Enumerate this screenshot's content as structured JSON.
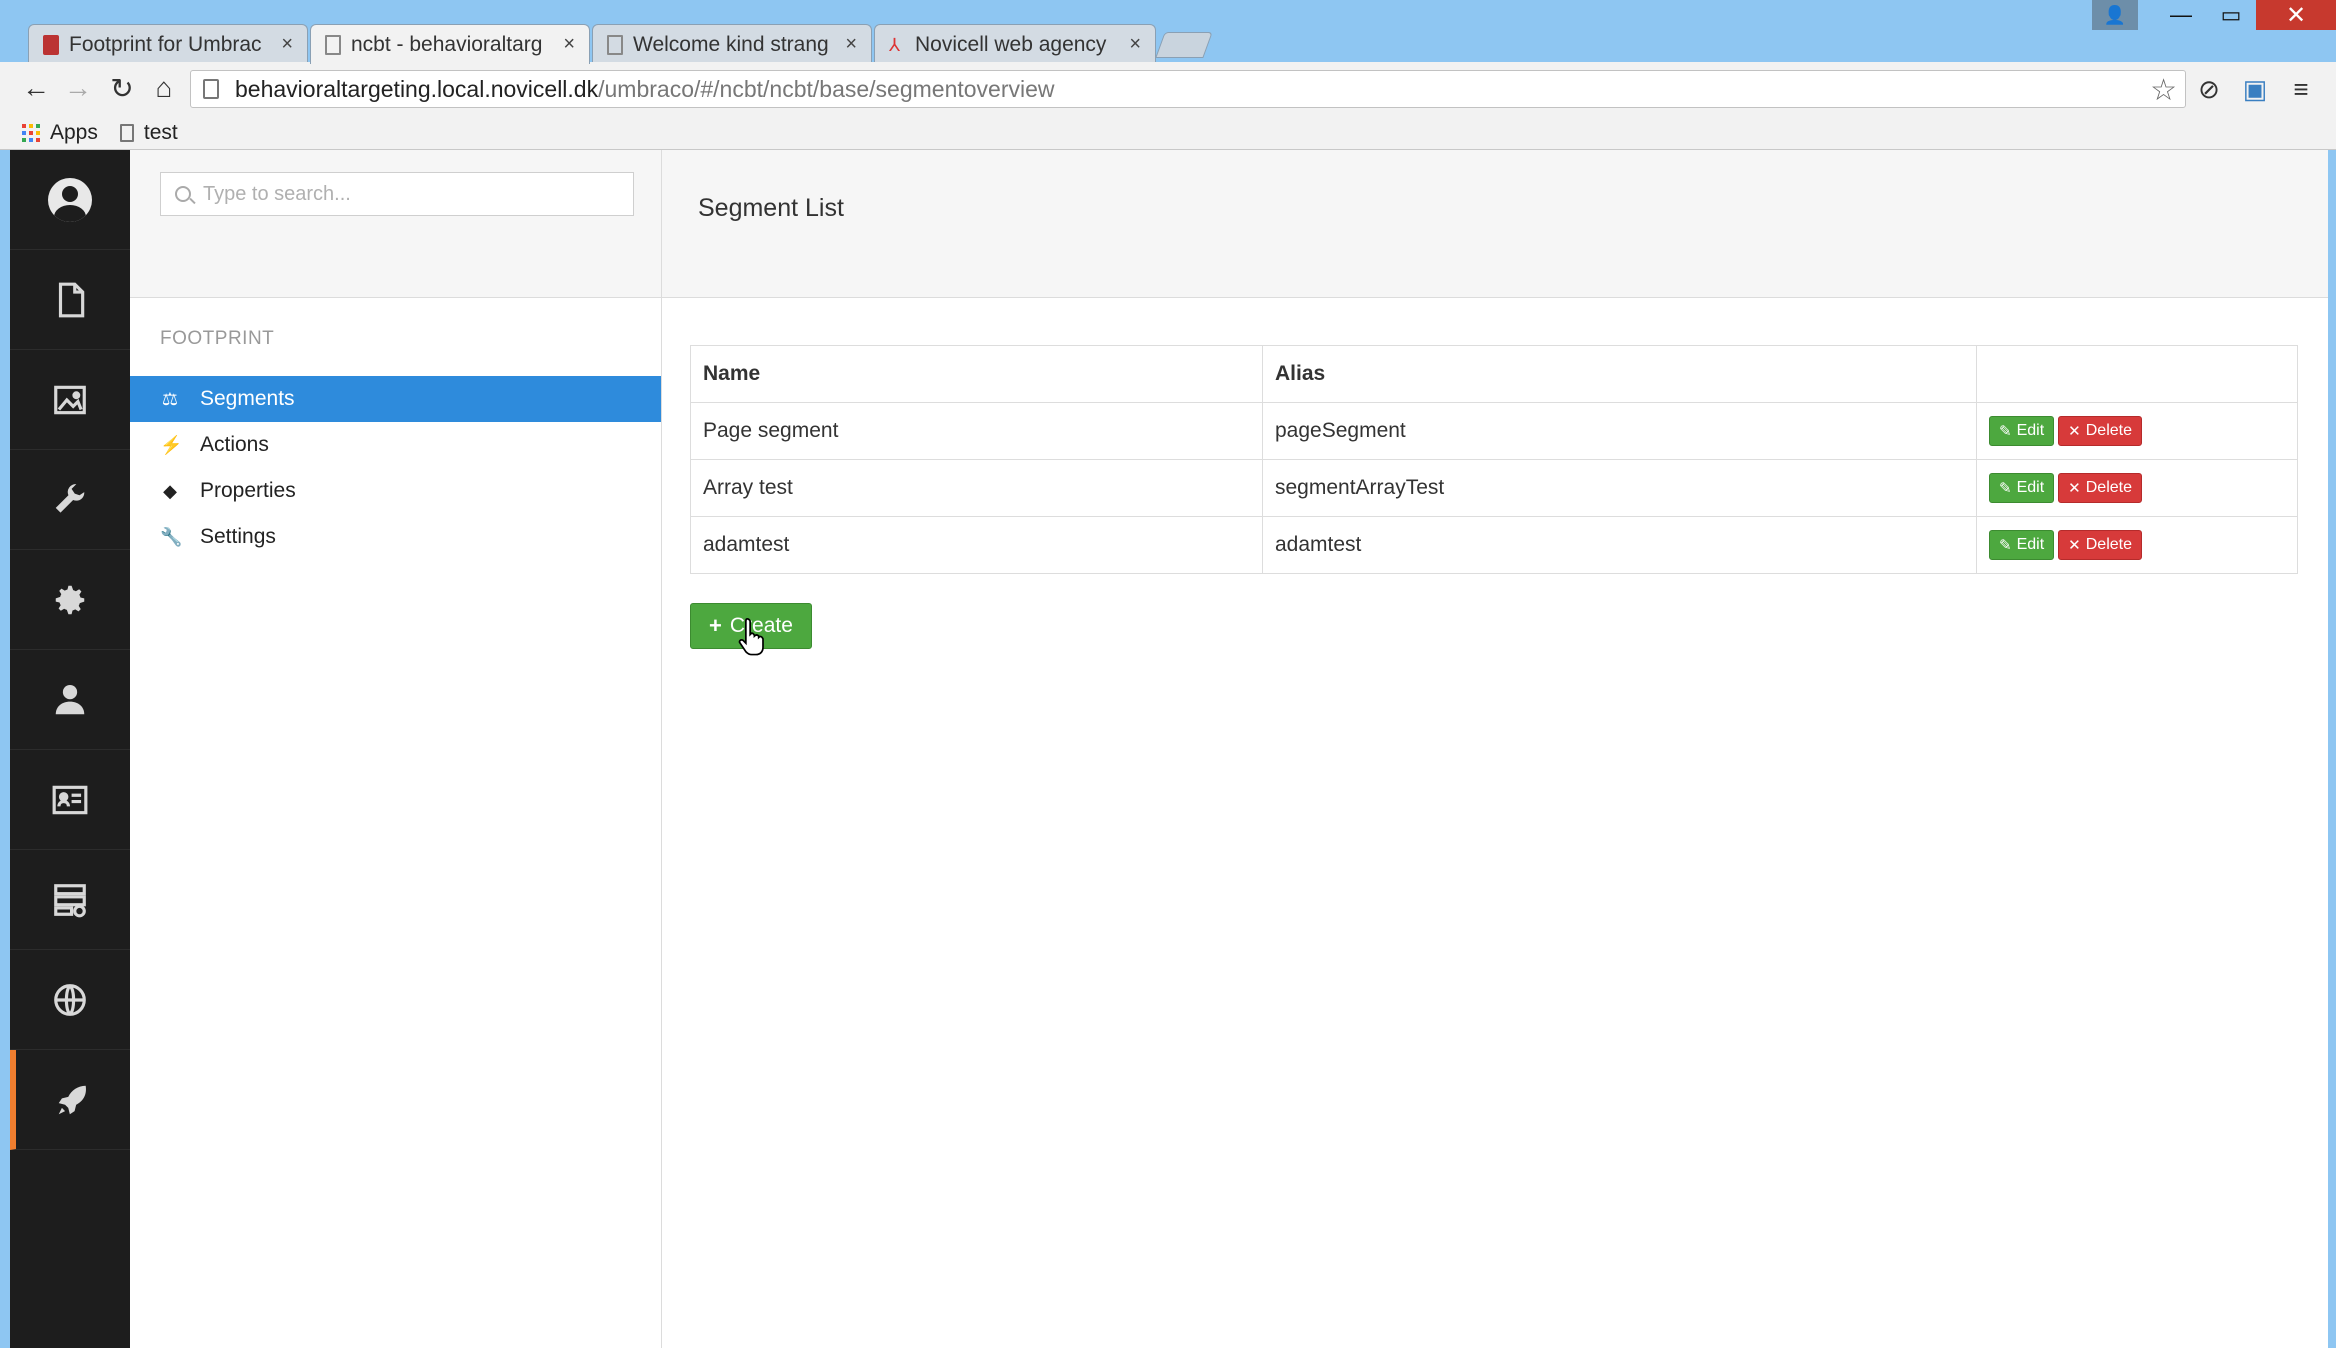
{
  "browser": {
    "tabs": [
      {
        "title": "Footprint for Umbrac",
        "active": false
      },
      {
        "title": "ncbt - behavioraltarg",
        "active": true
      },
      {
        "title": "Welcome kind strang",
        "active": false
      },
      {
        "title": "Novicell web agency",
        "active": false
      }
    ],
    "tab_close": "×",
    "url_host": "behavioraltargeting.local.novicell.dk",
    "url_path": "/umbraco/#/ncbt/ncbt/base/segmentoverview",
    "bookmarks": [
      {
        "label": "Apps"
      },
      {
        "label": "test"
      }
    ],
    "colors": {
      "apps_grid": [
        "#e94235",
        "#fbbc04",
        "#34a853",
        "#4285f4",
        "#e94235",
        "#fbbc04",
        "#34a853",
        "#4285f4",
        "#e94235"
      ]
    }
  },
  "sidebar": {
    "icons": [
      "avatar",
      "content-icon",
      "media-icon",
      "developer-icon",
      "settings-icon",
      "users-icon",
      "members-icon",
      "forms-icon",
      "translation-icon",
      "footprint-icon"
    ],
    "active": "footprint-icon",
    "accent": "#f07e2f"
  },
  "tree": {
    "search_placeholder": "Type to search...",
    "section_label": "FOOTPRINT",
    "items": [
      {
        "label": "Segments",
        "icon": "scale-icon",
        "glyph": "⚖",
        "active": true
      },
      {
        "label": "Actions",
        "icon": "bolt-icon",
        "glyph": "⚡",
        "active": false
      },
      {
        "label": "Properties",
        "icon": "tag-icon",
        "glyph": "◆",
        "active": false
      },
      {
        "label": "Settings",
        "icon": "wrench-icon",
        "glyph": "🔧",
        "active": false
      }
    ],
    "active_color": "#2e8bdc"
  },
  "main": {
    "title": "Segment List",
    "columns": [
      "Name",
      "Alias",
      ""
    ],
    "rows": [
      {
        "name": "Page segment",
        "alias": "pageSegment"
      },
      {
        "name": "Array test",
        "alias": "segmentArrayTest"
      },
      {
        "name": "adamtest",
        "alias": "adamtest"
      }
    ],
    "edit_label": "Edit",
    "delete_label": "Delete",
    "create_label": "Create",
    "colors": {
      "edit": "#4da83f",
      "delete": "#d73a3a",
      "create": "#4da83f"
    }
  }
}
